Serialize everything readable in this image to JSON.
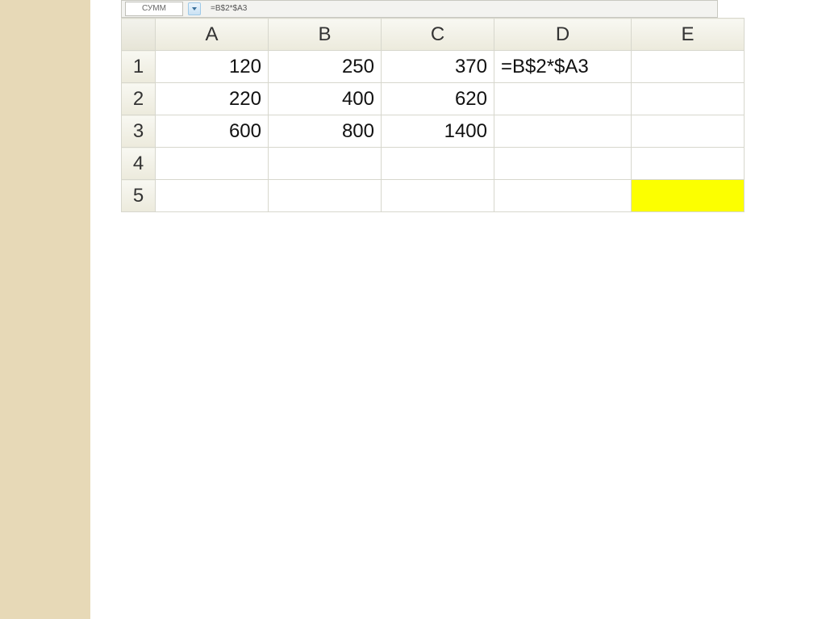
{
  "formulaBar": {
    "nameBox": "СУММ",
    "formula": "=B$2*$A3"
  },
  "columns": [
    "A",
    "B",
    "C",
    "D",
    "E"
  ],
  "rowNumbers": [
    "1",
    "2",
    "3",
    "4",
    "5"
  ],
  "cells": {
    "r1": {
      "A": "120",
      "B": "250",
      "C": "370",
      "D": "=B$2*$A3",
      "E": ""
    },
    "r2": {
      "A": "220",
      "B": "400",
      "C": "620",
      "D": "",
      "E": ""
    },
    "r3": {
      "A": "600",
      "B": "800",
      "C": "1400",
      "D": "",
      "E": ""
    },
    "r4": {
      "A": "",
      "B": "",
      "C": "",
      "D": "",
      "E": ""
    },
    "r5": {
      "A": "",
      "B": "",
      "C": "",
      "D": "",
      "E": ""
    }
  },
  "highlight": {
    "row": 5,
    "col": "E"
  }
}
